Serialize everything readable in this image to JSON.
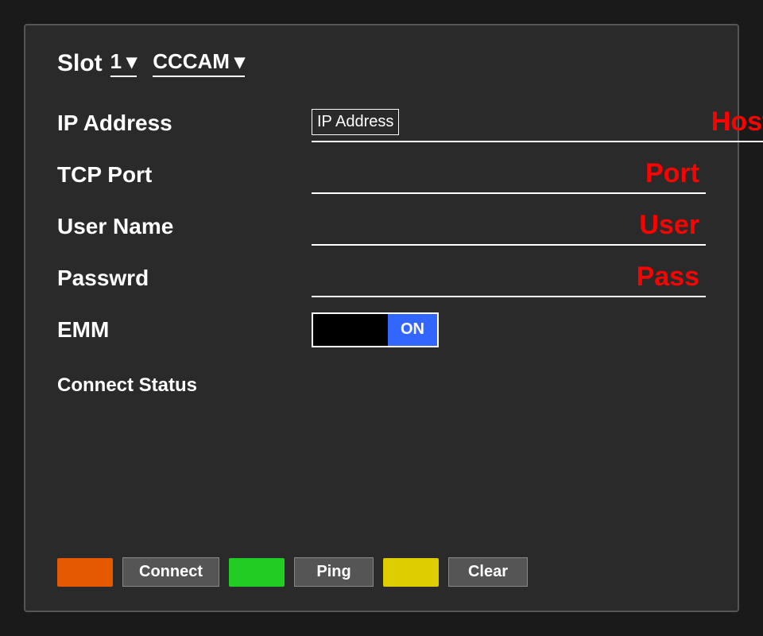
{
  "slot": {
    "label": "Slot",
    "value": "1",
    "protocol": "CCCAM"
  },
  "fields": {
    "ip_address": {
      "label": "IP Address",
      "prefix": "IP Address",
      "value": "Host"
    },
    "tcp_port": {
      "label": "TCP Port",
      "value": "Port"
    },
    "user_name": {
      "label": "User Name",
      "value": "User"
    },
    "password": {
      "label": "Passwrd",
      "value": "Pass"
    },
    "emm": {
      "label": "EMM",
      "toggle_off": "",
      "toggle_on": "ON"
    },
    "connect_status": {
      "label": "Connect Status"
    }
  },
  "buttons": {
    "connect": "Connect",
    "ping": "Ping",
    "clear": "Clear"
  }
}
